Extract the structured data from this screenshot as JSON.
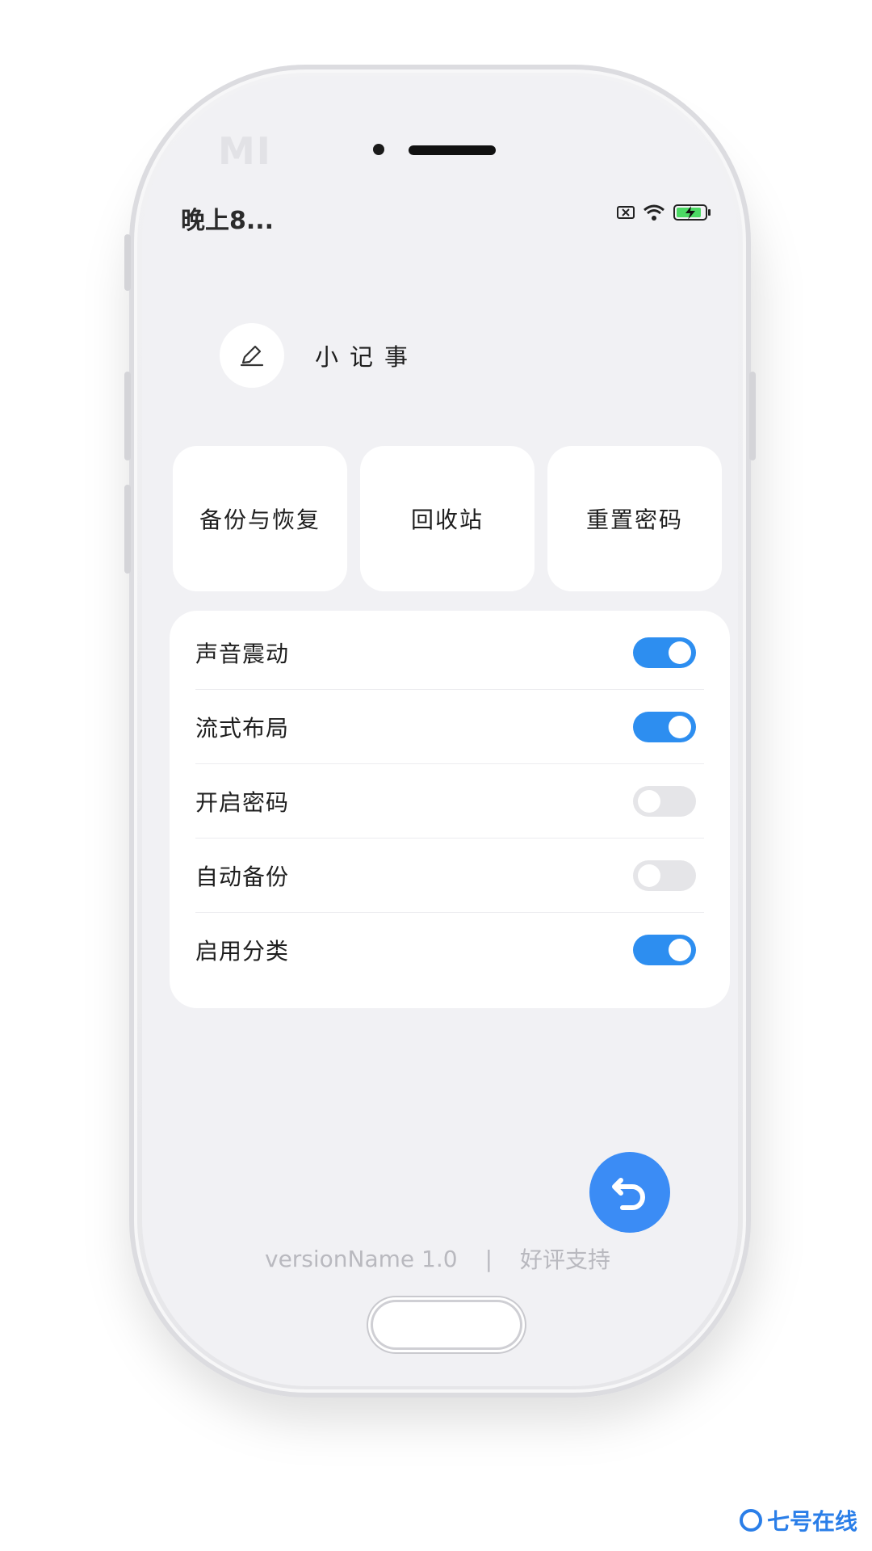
{
  "status_bar": {
    "time": "晚上8...",
    "icons": [
      "no-sim-icon",
      "wifi-icon",
      "battery-charging-icon"
    ]
  },
  "device": {
    "brand_logo": "MI"
  },
  "header": {
    "avatar_icon": "edit-pen-icon",
    "app_title": "小记事"
  },
  "quick_actions": [
    {
      "label": "备份与恢复"
    },
    {
      "label": "回收站"
    },
    {
      "label": "重置密码"
    }
  ],
  "settings": [
    {
      "label": "声音震动",
      "enabled": true
    },
    {
      "label": "流式布局",
      "enabled": true
    },
    {
      "label": "开启密码",
      "enabled": false
    },
    {
      "label": "自动备份",
      "enabled": false
    },
    {
      "label": "启用分类",
      "enabled": true
    }
  ],
  "fab": {
    "icon": "undo-back-icon"
  },
  "footer": {
    "version": "versionName 1.0",
    "separator": "|",
    "rate_link": "好评支持"
  },
  "watermark": {
    "text": "七号在线"
  },
  "colors": {
    "accent": "#2d8ef0",
    "fab": "#3b8cf5",
    "toggle_off": "#e5e5e8",
    "background": "#f1f1f4",
    "card": "#ffffff"
  }
}
